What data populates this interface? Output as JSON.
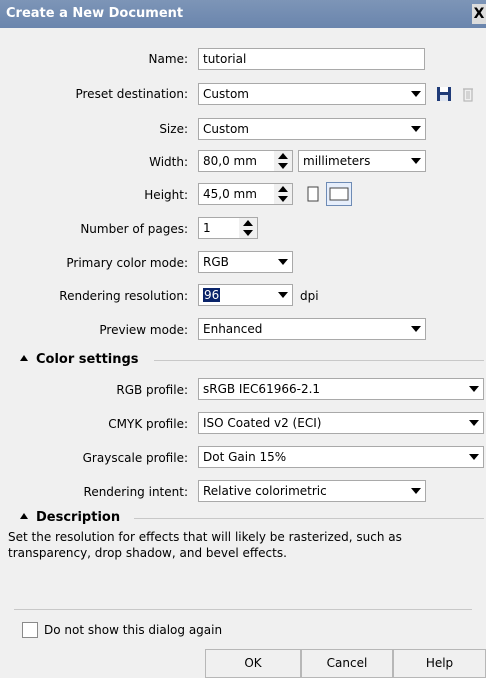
{
  "window": {
    "title": "Create a New Document",
    "close_glyph": "X"
  },
  "fields": {
    "name": {
      "label": "Name:",
      "value": "tutorial"
    },
    "preset": {
      "label": "Preset destination:",
      "value": "Custom"
    },
    "size": {
      "label": "Size:",
      "value": "Custom"
    },
    "width": {
      "label": "Width:",
      "value": "80,0 mm",
      "unit": "millimeters"
    },
    "height": {
      "label": "Height:",
      "value": "45,0 mm"
    },
    "pages": {
      "label": "Number of pages:",
      "value": "1"
    },
    "color_mode": {
      "label": "Primary color mode:",
      "value": "RGB"
    },
    "resolution": {
      "label": "Rendering resolution:",
      "value": "96",
      "unit": "dpi"
    },
    "preview": {
      "label": "Preview mode:",
      "value": "Enhanced"
    }
  },
  "color_settings": {
    "heading": "Color settings",
    "rgb_profile": {
      "label": "RGB profile:",
      "value": "sRGB IEC61966-2.1"
    },
    "cmyk_profile": {
      "label": "CMYK profile:",
      "value": "ISO Coated v2 (ECI)"
    },
    "gray_profile": {
      "label": "Grayscale profile:",
      "value": "Dot Gain 15%"
    },
    "intent": {
      "label": "Rendering intent:",
      "value": "Relative colorimetric"
    }
  },
  "description": {
    "heading": "Description",
    "text": "Set the resolution for effects that will likely be rasterized, such as transparency, drop shadow, and bevel effects."
  },
  "footer": {
    "dont_show": "Do not show this dialog again",
    "ok": "OK",
    "cancel": "Cancel",
    "help": "Help"
  },
  "icons": {
    "save": "save-icon",
    "delete": "delete-icon",
    "portrait": "portrait-icon",
    "landscape": "landscape-icon"
  },
  "colors": {
    "titlebar": "#6a85ad",
    "selection": "#0a246a"
  }
}
